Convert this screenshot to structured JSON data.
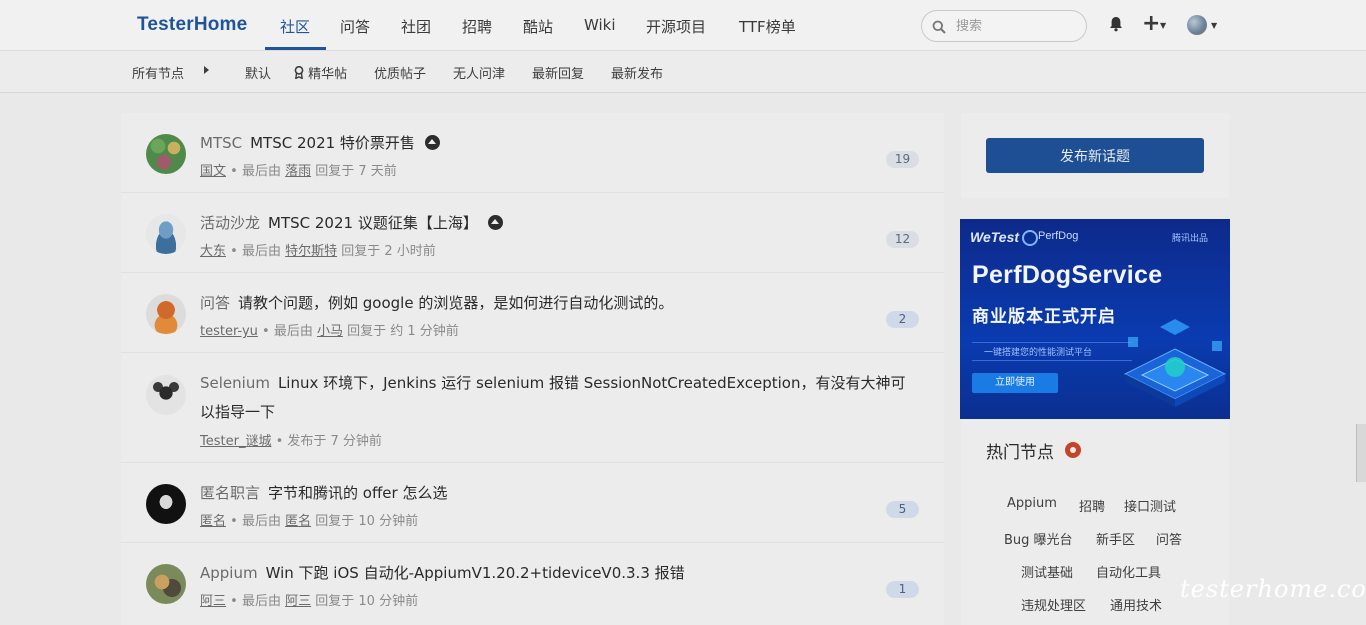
{
  "brand": "TesterHome",
  "nav": {
    "items": [
      "社区",
      "问答",
      "社团",
      "招聘",
      "酷站",
      "Wiki",
      "开源项目",
      "TTF榜单"
    ],
    "search_placeholder": "搜索"
  },
  "subnav": {
    "all_nodes": "所有节点",
    "filters": [
      "默认",
      "精华帖",
      "优质帖子",
      "无人问津",
      "最新回复",
      "最新发布"
    ]
  },
  "topics": [
    {
      "node": "MTSC",
      "title": "MTSC 2021 特价票开售",
      "pinned": true,
      "author": "国文",
      "last_label": "最后由",
      "last_user": "落雨",
      "time": "回复于 7 天前",
      "replies": "19"
    },
    {
      "node": "活动沙龙",
      "title": "MTSC 2021 议题征集【上海】",
      "pinned": true,
      "author": "大东",
      "last_label": "最后由",
      "last_user": "特尔斯特",
      "time": "回复于 2 小时前",
      "replies": "12"
    },
    {
      "node": "问答",
      "title": "请教个问题，例如 google 的浏览器，是如何进行自动化测试的。",
      "pinned": false,
      "author": "tester-yu",
      "last_label": "最后由",
      "last_user": "小马",
      "time": "回复于 约 1 分钟前",
      "replies": "2"
    },
    {
      "node": "Selenium",
      "title": "Linux 环境下，Jenkins 运行 selenium 报错 SessionNotCreatedException，有没有大神可以指导一下",
      "pinned": false,
      "author": "Tester_谜城",
      "time": "发布于 7 分钟前"
    },
    {
      "node": "匿名职言",
      "title": "字节和腾讯的 offer 怎么选",
      "pinned": false,
      "author": "匿名",
      "last_label": "最后由",
      "last_user": "匿名",
      "time": "回复于 10 分钟前",
      "replies": "5"
    },
    {
      "node": "Appium",
      "title": "Win 下跑 iOS 自动化-AppiumV1.20.2+tideviceV0.3.3 报错",
      "pinned": false,
      "author": "阿三",
      "last_label": "最后由",
      "last_user": "阿三",
      "time": "回复于 10 分钟前",
      "replies": "1"
    }
  ],
  "sidebar": {
    "new_topic": "发布新话题",
    "ad": {
      "brand1": "WeTest",
      "brand2": "PerfDog",
      "tag": "腾讯出品",
      "headline": "PerfDogService",
      "subheadline": "商业版本正式开启",
      "tagline": "一键搭建您的性能测试平台",
      "button": "立即使用"
    },
    "hot_title": "热门节点",
    "hot_nodes": [
      "Appium",
      "招聘",
      "接口测试",
      "Bug 曝光台",
      "新手区",
      "问答",
      "测试基础",
      "自动化工具",
      "违规处理区",
      "通用技术"
    ]
  },
  "watermark": "testerhome.com",
  "colors": {
    "accent": "#1f5598",
    "button": "#1e4f94",
    "hot_dot": "#c4442a"
  }
}
